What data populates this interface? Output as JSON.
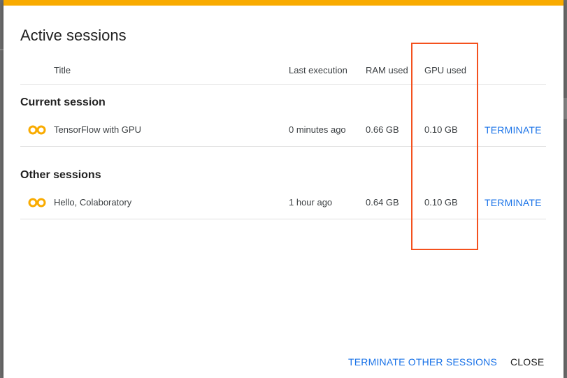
{
  "dialog": {
    "title": "Active sessions",
    "accent_color": "#f9ab00",
    "columns": {
      "title": "Title",
      "last_execution": "Last execution",
      "ram_used": "RAM used",
      "gpu_used": "GPU used"
    },
    "current_section": {
      "heading": "Current session",
      "row": {
        "icon": "colab-logo-icon",
        "title": "TensorFlow with GPU",
        "last_execution": "0 minutes ago",
        "ram": "0.66 GB",
        "gpu": "0.10 GB",
        "action": "TERMINATE"
      }
    },
    "other_section": {
      "heading": "Other sessions",
      "row": {
        "icon": "colab-logo-icon",
        "title": "Hello, Colaboratory",
        "last_execution": "1 hour ago",
        "ram": "0.64 GB",
        "gpu": "0.10 GB",
        "action": "TERMINATE"
      }
    },
    "footer": {
      "terminate_others": "TERMINATE OTHER SESSIONS",
      "close": "CLOSE"
    },
    "link_color": "#1a73e8",
    "highlight_color": "#f4511e"
  }
}
